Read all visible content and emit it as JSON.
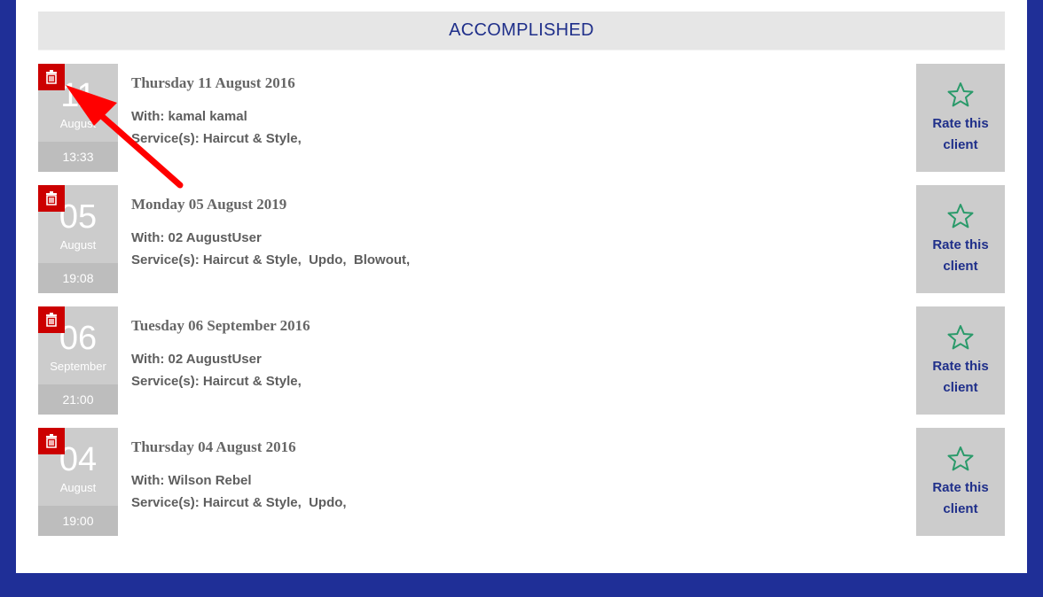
{
  "section": {
    "title": "ACCOMPLISHED"
  },
  "colors": {
    "page_background": "#1f2f97",
    "header_text": "#1f2f8a",
    "delete_red": "#cc0000",
    "star_green": "#2a9a6a",
    "annotation_arrow": "#ff0000"
  },
  "icons": {
    "delete": "trash-icon",
    "rate": "star-outline-icon",
    "annotation": "red-arrow"
  },
  "appointments": [
    {
      "day": "11",
      "month": "August",
      "time": "13:33",
      "title": "Thursday 11 August 2016",
      "with": "With: kamal kamal",
      "services": "Service(s): Haircut & Style,",
      "rate_label_1": "Rate this",
      "rate_label_2": "client"
    },
    {
      "day": "05",
      "month": "August",
      "time": "19:08",
      "title": "Monday 05 August 2019",
      "with": "With: 02 AugustUser",
      "services": "Service(s): Haircut & Style,  Updo,  Blowout,",
      "rate_label_1": "Rate this",
      "rate_label_2": "client"
    },
    {
      "day": "06",
      "month": "September",
      "time": "21:00",
      "title": "Tuesday 06 September 2016",
      "with": "With: 02 AugustUser",
      "services": "Service(s): Haircut & Style,",
      "rate_label_1": "Rate this",
      "rate_label_2": "client"
    },
    {
      "day": "04",
      "month": "August",
      "time": "19:00",
      "title": "Thursday 04 August 2016",
      "with": "With: Wilson Rebel",
      "services": "Service(s): Haircut & Style,  Updo,",
      "rate_label_1": "Rate this",
      "rate_label_2": "client"
    }
  ]
}
